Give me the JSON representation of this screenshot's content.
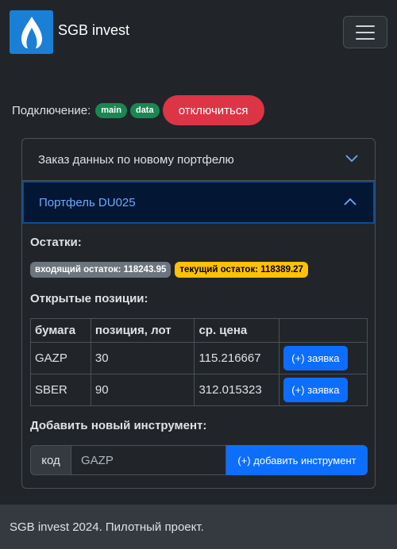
{
  "navbar": {
    "brand": "SGB invest"
  },
  "connection": {
    "label": "Подключение:",
    "pills": [
      "main",
      "data"
    ],
    "disconnect_label": "отключиться"
  },
  "accordion": {
    "item1_title": "Заказ данных по новому портфелю",
    "item2_title": "Портфель DU025"
  },
  "portfolio": {
    "balances_title": "Остатки:",
    "incoming_balance": "входящий остаток: 118243.95",
    "current_balance": "текущий остаток: 118389.27",
    "positions_title": "Открытые позиции:",
    "columns": [
      "бумага",
      "позиция, лот",
      "ср. цена",
      ""
    ],
    "rows": [
      {
        "ticker": "GAZP",
        "position": "30",
        "avg_price": "115.216667",
        "action": "(+) заявка"
      },
      {
        "ticker": "SBER",
        "position": "90",
        "avg_price": "312.015323",
        "action": "(+) заявка"
      }
    ],
    "add_title": "Добавить новый инструмент:",
    "add_label": "код",
    "add_input_value": "GAZP",
    "add_button": "(+) добавить инструмент"
  },
  "footer": {
    "text": "SGB invest 2024. Пилотный проект."
  }
}
